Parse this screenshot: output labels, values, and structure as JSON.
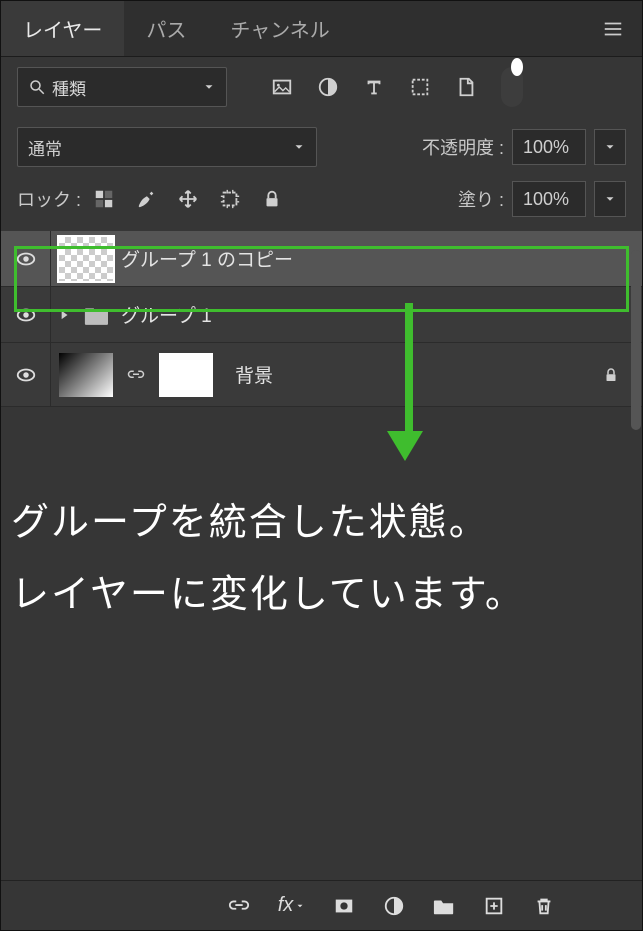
{
  "tabs": {
    "layers": "レイヤー",
    "paths": "パス",
    "channels": "チャンネル"
  },
  "filter": {
    "kind": "種類"
  },
  "blend": {
    "mode": "通常",
    "opacity_label": "不透明度 :",
    "opacity_value": "100%"
  },
  "lock": {
    "label": "ロック :",
    "fill_label": "塗り :",
    "fill_value": "100%"
  },
  "layers": [
    {
      "name": "グループ 1 のコピー"
    },
    {
      "name": "グループ 1"
    },
    {
      "name": "背景"
    }
  ],
  "annotation": {
    "line1": "グループを統合した状態。",
    "line2": "レイヤーに変化しています。"
  }
}
